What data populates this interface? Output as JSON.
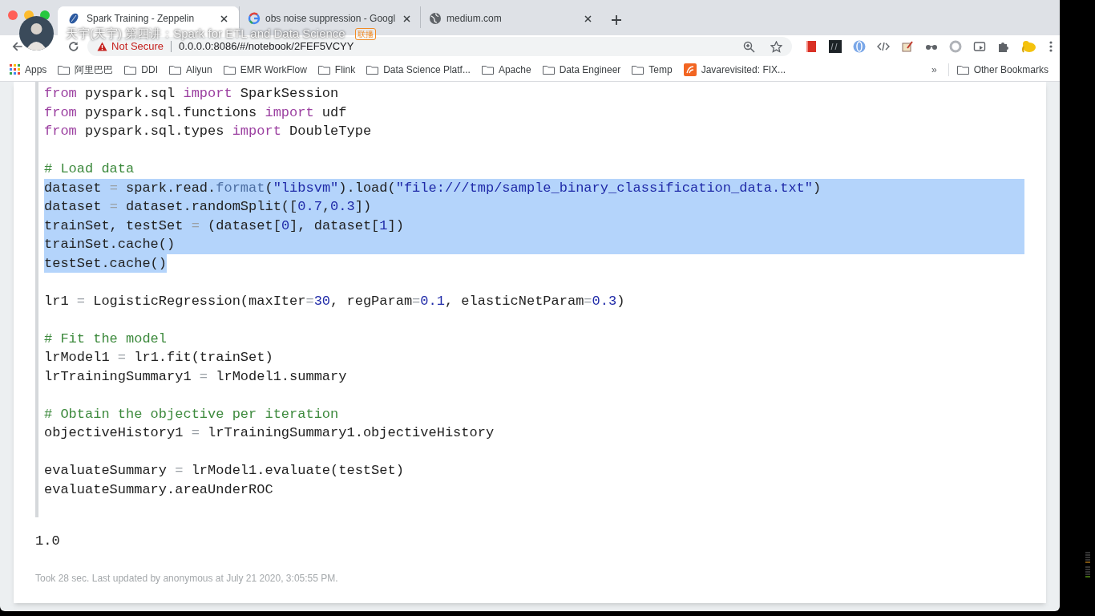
{
  "overlay": {
    "title": "天宇(天宇) 第四讲：Spark for ETL and Data Science",
    "badge": "联播"
  },
  "tabs": [
    {
      "title": "Spark Training - Zeppelin",
      "kind": "zeppelin",
      "selected": true
    },
    {
      "title": "obs noise suppression - Googl",
      "kind": "google",
      "selected": false
    },
    {
      "title": "medium.com",
      "kind": "globe",
      "selected": false
    }
  ],
  "address_bar": {
    "security": "Not Secure",
    "url": "0.0.0.0:8086/#/notebook/2FEF5VCYY"
  },
  "bookmarks": [
    {
      "label": "Apps",
      "kind": "apps"
    },
    {
      "label": "阿里巴巴",
      "kind": "folder"
    },
    {
      "label": "DDI",
      "kind": "folder"
    },
    {
      "label": "Aliyun",
      "kind": "folder"
    },
    {
      "label": "EMR WorkFlow",
      "kind": "folder"
    },
    {
      "label": "Flink",
      "kind": "folder"
    },
    {
      "label": "Data Science Platf...",
      "kind": "folder"
    },
    {
      "label": "Apache",
      "kind": "folder"
    },
    {
      "label": "Data Engineer",
      "kind": "folder"
    },
    {
      "label": "Temp",
      "kind": "folder"
    },
    {
      "label": "Javarevisited: FIX...",
      "kind": "site"
    }
  ],
  "bookmarks_overflow": "»",
  "other_bookmarks": "Other Bookmarks",
  "code_blocks": [
    [
      {
        "selected": false,
        "tokens": [
          {
            "text": "from",
            "kind": "kw"
          },
          {
            "text": " pyspark.sql ",
            "kind": "p"
          },
          {
            "text": "import",
            "kind": "kw"
          },
          {
            "text": " SparkSession",
            "kind": "p"
          }
        ]
      },
      {
        "selected": false,
        "tokens": [
          {
            "text": "from",
            "kind": "kw"
          },
          {
            "text": " pyspark.sql.functions ",
            "kind": "p"
          },
          {
            "text": "import",
            "kind": "kw"
          },
          {
            "text": " udf",
            "kind": "p"
          }
        ]
      },
      {
        "selected": false,
        "tokens": [
          {
            "text": "from",
            "kind": "kw"
          },
          {
            "text": " pyspark.sql.types ",
            "kind": "p"
          },
          {
            "text": "import",
            "kind": "kw"
          },
          {
            "text": " DoubleType",
            "kind": "p"
          }
        ]
      }
    ],
    [
      {
        "selected": false,
        "tokens": [
          {
            "text": "# Load data",
            "kind": "c"
          }
        ]
      },
      {
        "selected": true,
        "tokens": [
          {
            "text": "dataset ",
            "kind": "p"
          },
          {
            "text": "=",
            "kind": "op"
          },
          {
            "text": " spark.read.",
            "kind": "p"
          },
          {
            "text": "format",
            "kind": "fn"
          },
          {
            "text": "(",
            "kind": "p"
          },
          {
            "text": "\"libsvm\"",
            "kind": "s"
          },
          {
            "text": ").load(",
            "kind": "p"
          },
          {
            "text": "\"file:///tmp/sample_binary_classification_data.txt\"",
            "kind": "s"
          },
          {
            "text": ")",
            "kind": "p"
          }
        ]
      },
      {
        "selected": true,
        "tokens": [
          {
            "text": "dataset ",
            "kind": "p"
          },
          {
            "text": "=",
            "kind": "op"
          },
          {
            "text": " dataset.randomSplit([",
            "kind": "p"
          },
          {
            "text": "0.7",
            "kind": "n"
          },
          {
            "text": ",",
            "kind": "p"
          },
          {
            "text": "0.3",
            "kind": "n"
          },
          {
            "text": "])",
            "kind": "p"
          }
        ]
      },
      {
        "selected": true,
        "tokens": [
          {
            "text": "trainSet, testSet ",
            "kind": "p"
          },
          {
            "text": "=",
            "kind": "op"
          },
          {
            "text": " (dataset[",
            "kind": "p"
          },
          {
            "text": "0",
            "kind": "n"
          },
          {
            "text": "], dataset[",
            "kind": "p"
          },
          {
            "text": "1",
            "kind": "n"
          },
          {
            "text": "])",
            "kind": "p"
          }
        ]
      },
      {
        "selected": true,
        "tokens": [
          {
            "text": "trainSet.cache()",
            "kind": "p"
          }
        ]
      },
      {
        "selected": true,
        "tokens": [
          {
            "text": "testSet.cache()",
            "kind": "p"
          }
        ]
      }
    ],
    [
      {
        "selected": false,
        "tokens": [
          {
            "text": "lr1 ",
            "kind": "p"
          },
          {
            "text": "=",
            "kind": "op"
          },
          {
            "text": " LogisticRegression(maxIter",
            "kind": "p"
          },
          {
            "text": "=",
            "kind": "op"
          },
          {
            "text": "30",
            "kind": "n"
          },
          {
            "text": ", regParam",
            "kind": "p"
          },
          {
            "text": "=",
            "kind": "op"
          },
          {
            "text": "0.1",
            "kind": "n"
          },
          {
            "text": ", elasticNetParam",
            "kind": "p"
          },
          {
            "text": "=",
            "kind": "op"
          },
          {
            "text": "0.3",
            "kind": "n"
          },
          {
            "text": ")",
            "kind": "p"
          }
        ]
      }
    ],
    [
      {
        "selected": false,
        "tokens": [
          {
            "text": "# Fit the model",
            "kind": "c"
          }
        ]
      },
      {
        "selected": false,
        "tokens": [
          {
            "text": "lrModel1 ",
            "kind": "p"
          },
          {
            "text": "=",
            "kind": "op"
          },
          {
            "text": " lr1.fit(trainSet)",
            "kind": "p"
          }
        ]
      },
      {
        "selected": false,
        "tokens": [
          {
            "text": "lrTrainingSummary1 ",
            "kind": "p"
          },
          {
            "text": "=",
            "kind": "op"
          },
          {
            "text": " lrModel1.summary",
            "kind": "p"
          }
        ]
      }
    ],
    [
      {
        "selected": false,
        "tokens": [
          {
            "text": "# Obtain the objective per iteration",
            "kind": "c"
          }
        ]
      },
      {
        "selected": false,
        "tokens": [
          {
            "text": "objectiveHistory1 ",
            "kind": "p"
          },
          {
            "text": "=",
            "kind": "op"
          },
          {
            "text": " lrTrainingSummary1.objectiveHistory",
            "kind": "p"
          }
        ]
      }
    ],
    [
      {
        "selected": false,
        "tokens": [
          {
            "text": "evaluateSummary ",
            "kind": "p"
          },
          {
            "text": "=",
            "kind": "op"
          },
          {
            "text": " lrModel1.evaluate(testSet)",
            "kind": "p"
          }
        ]
      },
      {
        "selected": false,
        "tokens": [
          {
            "text": "evaluateSummary.areaUnderROC",
            "kind": "p"
          }
        ]
      }
    ]
  ],
  "output": "1.0",
  "footer": "Took 28 sec. Last updated by anonymous at July 21 2020, 3:05:55 PM."
}
